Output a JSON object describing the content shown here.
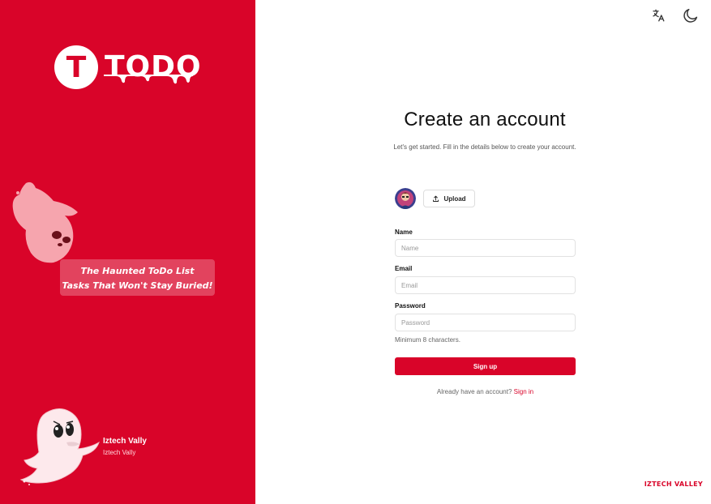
{
  "brand": {
    "logo_letter": "T",
    "logo_text": "TODO",
    "footer_brand": "IZTECH VALLEY"
  },
  "tagline": {
    "line1": "The Haunted ToDo List",
    "line2": "Tasks That Won't Stay Buried!"
  },
  "author": {
    "name": "Iztech Vally",
    "subtitle": "Iztech Vally"
  },
  "header": {
    "icons": [
      "translate-icon",
      "moon-icon"
    ]
  },
  "form": {
    "title": "Create an account",
    "subtitle": "Let's get started. Fill in the details below to create your account.",
    "upload_label": "Upload",
    "name_label": "Name",
    "name_placeholder": "Name",
    "email_label": "Email",
    "email_placeholder": "Email",
    "password_label": "Password",
    "password_placeholder": "Password",
    "password_hint": "Minimum 8 characters.",
    "submit_label": "Sign up",
    "signin_prompt": "Already have an account?",
    "signin_link": "Sign in"
  },
  "colors": {
    "accent": "#d90429",
    "background": "#ffffff"
  }
}
